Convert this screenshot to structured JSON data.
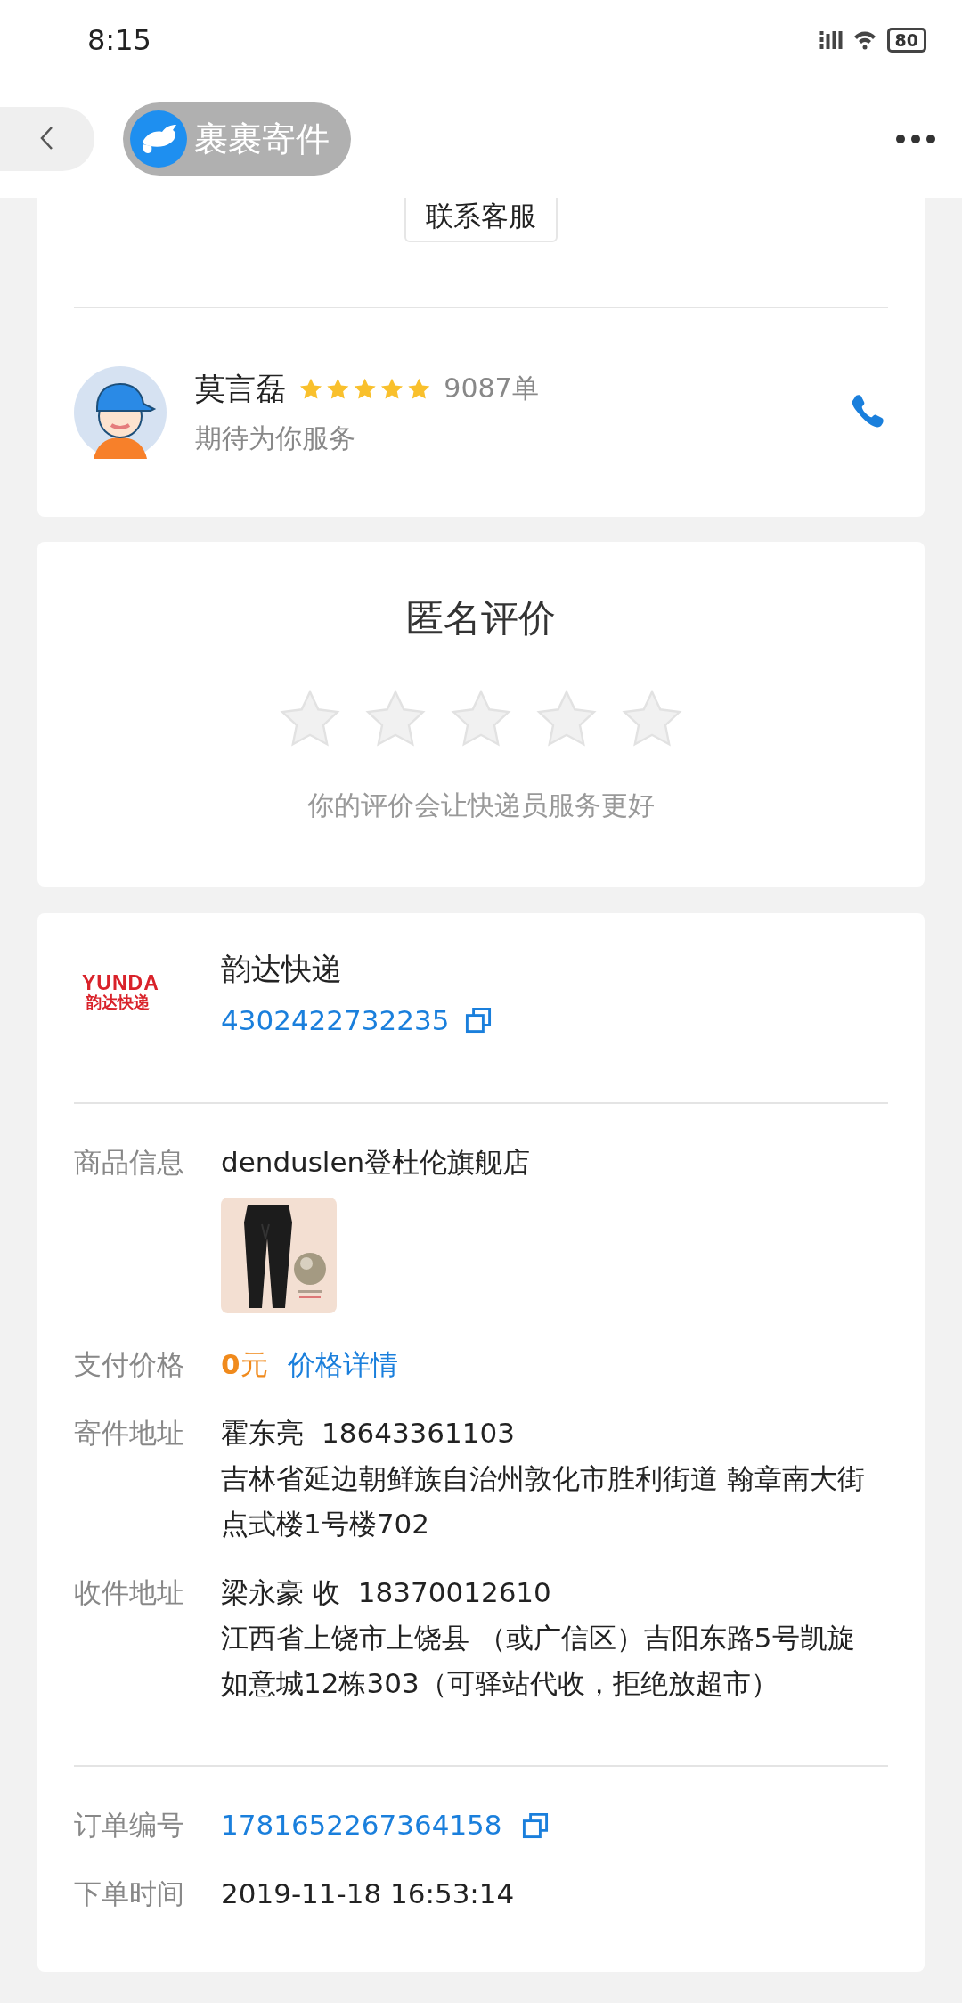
{
  "status_bar": {
    "time": "8:15",
    "battery": "80"
  },
  "header": {
    "title": "裹裹寄件"
  },
  "contact_button": "联系客服",
  "courier": {
    "name": "莫言磊",
    "stars": 5,
    "orders": "9087单",
    "slogan": "期待为你服务"
  },
  "rating": {
    "title": "匿名评价",
    "stars": 0,
    "hint": "你的评价会让快递员服务更好"
  },
  "carrier": {
    "logo_text": "YUNDA",
    "logo_subtitle": "韵达快递",
    "name": "韵达快递",
    "tracking_number": "4302422732235"
  },
  "details": [
    {
      "kind": "product",
      "label": "商品信息",
      "value": "denduslen登杜伦旗舰店"
    },
    {
      "kind": "price",
      "label": "支付价格",
      "value": "**0**元",
      "link": "价格详情"
    },
    {
      "kind": "address",
      "label": "寄件地址",
      "name": "霍东亮",
      "phone": "18643361103",
      "address": "吉林省延边朝鲜族自治州敦化市胜利街道 翰章南大街点式楼1号楼702"
    },
    {
      "kind": "address",
      "label": "收件地址",
      "name": "梁永豪 收",
      "phone": "18370012610",
      "address": "江西省上饶市上饶县 （或广信区）吉阳东路5号凯旋如意城12栋303（可驿站代收，拒绝放超市）"
    }
  ],
  "order": [
    {
      "kind": "copyable",
      "label": "订单编号",
      "value": "1781652267364158"
    },
    {
      "kind": "plain",
      "label": "下单时间",
      "value": "2019-11-18 16:53:14"
    }
  ]
}
